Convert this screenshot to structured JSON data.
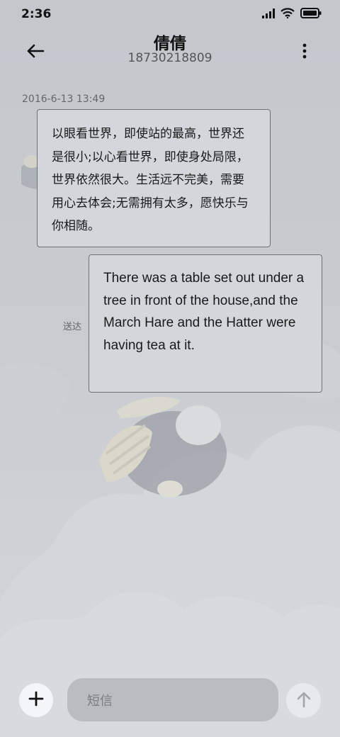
{
  "status_bar": {
    "time": "2:36",
    "icons": [
      "signal-icon",
      "wifi-icon",
      "battery-icon"
    ]
  },
  "header": {
    "back_icon": "arrow-left-icon",
    "contact_name": "倩倩",
    "contact_number": "18730218809",
    "more_icon": "more-vertical-icon"
  },
  "conversation": {
    "timestamp": "2016-6-13 13:49",
    "messages": [
      {
        "direction": "incoming",
        "text": "以眼看世界，即使站的最高，世界还是很小;以心看世界，即使身处局限，世界依然很大。生活远不完美，需要用心去体会;无需拥有太多，愿快乐与你相随。"
      },
      {
        "direction": "outgoing",
        "text": "There was a table set out under a tree in front of the house,and the March Hare and the Hatter were having tea at it.",
        "status": "送达"
      }
    ]
  },
  "composer": {
    "add_icon": "plus-icon",
    "placeholder": "短信",
    "send_icon": "arrow-up-icon"
  },
  "colors": {
    "background": "#c8cbd0",
    "bubble": "#d3d6da",
    "bubble_border": "#6e7277",
    "input": "#b9bdc2"
  }
}
